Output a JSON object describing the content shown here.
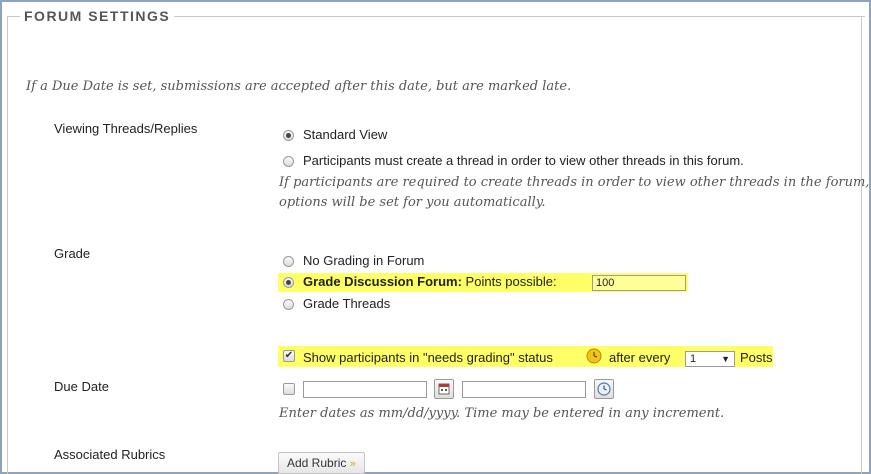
{
  "section": {
    "legend": "FORUM SETTINGS",
    "intro_note": "If a Due Date is set, submissions are accepted after this date, but are marked late."
  },
  "viewing": {
    "label": "Viewing Threads/Replies",
    "option_standard": "Standard View",
    "option_participants": "Participants must create a thread in order to view other threads in this forum.",
    "note_line1": "If participants are required to create threads in order to view other threads in the forum,",
    "note_line2": "options will be set for you automatically.",
    "selected": "Standard View"
  },
  "grade": {
    "label": "Grade",
    "option_no_grading": "No Grading in Forum",
    "option_grade_forum_bold": "Grade Discussion Forum:",
    "points_label": "Points possible:",
    "points_value": "100",
    "option_grade_threads": "Grade Threads",
    "selected": "Grade Discussion Forum:"
  },
  "needs_grading": {
    "checked": true,
    "label_before": "Show participants in \"needs grading\" status",
    "label_after": "after every",
    "select_value": "1",
    "label_posts": "Posts",
    "highlight_color": "#ffff66"
  },
  "due_date": {
    "label": "Due Date",
    "checked": false,
    "date_value": "",
    "time_value": "",
    "help": "Enter dates as mm/dd/yyyy. Time may be entered in any increment."
  },
  "rubrics": {
    "label": "Associated Rubrics",
    "add_button": "Add Rubric"
  }
}
